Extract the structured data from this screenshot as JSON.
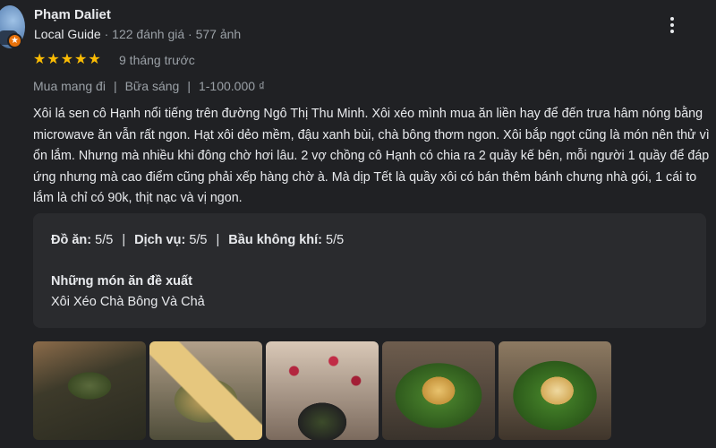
{
  "reviewer": {
    "name": "Phạm Daliet",
    "badge": "Local Guide",
    "stats": " · 122 đánh giá · 577 ảnh"
  },
  "review": {
    "stars": "★★★★★",
    "rating_value": 5,
    "time": "9 tháng trước",
    "attributes": [
      "Mua mang đi",
      "Bữa sáng",
      "1-100.000 ₫"
    ],
    "text": "Xôi lá sen cô Hạnh nổi tiếng trên đường Ngô Thị Thu Minh. Xôi xéo mình mua ăn liền hay để đến trưa hâm nóng bằng microwave ăn vẫn rất ngon. Hạt xôi dẻo mềm, đậu xanh bùi, chà bông thơm ngon. Xôi bắp ngọt cũng là món nên thử vì ổn lắm. Nhưng mà nhiều khi đông chờ hơi lâu. 2 vợ chồng cô Hạnh có chia ra 2 quầy kế bên, mỗi người 1 quầy để đáp ứng nhưng mà cao điểm cũng phải xếp hàng chờ à. Mà dịp Tết là quầy xôi có bán thêm bánh chưng nhà gói, 1 cái to lắm là chỉ có 90k, thịt nạc và vị ngon."
  },
  "ratings": {
    "food_label": "Đồ ăn:",
    "food_value": "5/5",
    "service_label": "Dịch vụ:",
    "service_value": "5/5",
    "atmosphere_label": "Bầu không khí:",
    "atmosphere_value": "5/5",
    "separator": "|"
  },
  "recommended": {
    "title": "Những món ăn đề xuất",
    "dishes": "Xôi Xéo Chà Bông Và Chả"
  },
  "photos": [
    "photo-1",
    "photo-2",
    "photo-3",
    "photo-4",
    "photo-5"
  ],
  "colors": {
    "background": "#202124",
    "star": "#fbbc04",
    "badge": "#e8710a",
    "muted_text": "#9aa0a6"
  },
  "icons": [
    "avatar",
    "local-guide-badge-icon",
    "more-options-icon",
    "star-icon"
  ]
}
